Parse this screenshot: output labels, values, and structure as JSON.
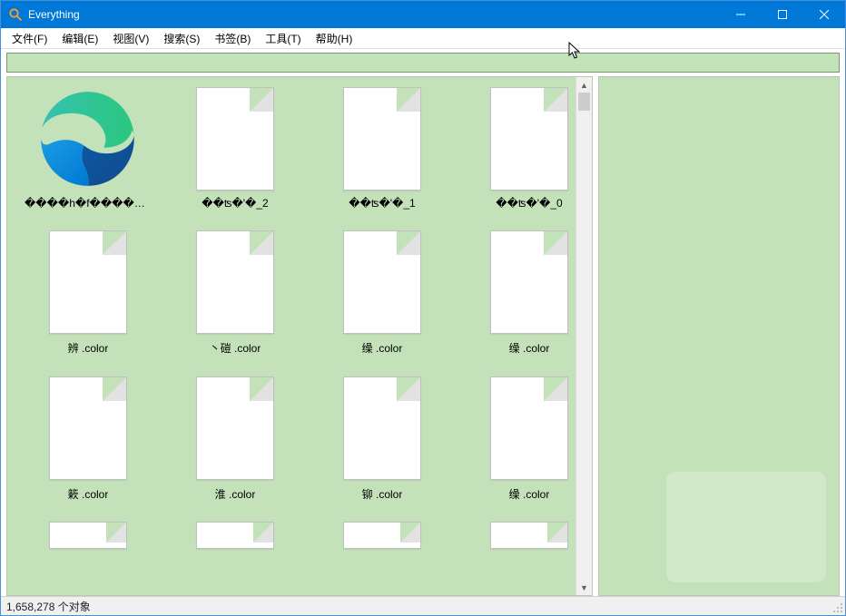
{
  "window": {
    "title": "Everything"
  },
  "menu": {
    "items": [
      "文件(F)",
      "编辑(E)",
      "视图(V)",
      "搜索(S)",
      "书签(B)",
      "工具(T)",
      "帮助(H)"
    ]
  },
  "search": {
    "value": "",
    "placeholder": ""
  },
  "results": {
    "items": [
      {
        "icon": "edge",
        "label": "����h�f���������...."
      },
      {
        "icon": "blank",
        "label": "��ʦ�'�_2"
      },
      {
        "icon": "blank",
        "label": "��ʦ�'�_1"
      },
      {
        "icon": "blank",
        "label": "��ʦ�'�_0"
      },
      {
        "icon": "blank",
        "label": "辨   .color"
      },
      {
        "icon": "blank",
        "label": "丶磑   .color"
      },
      {
        "icon": "blank",
        "label": "缲   .color"
      },
      {
        "icon": "blank",
        "label": "缲   .color"
      },
      {
        "icon": "blank",
        "label": "簌   .color"
      },
      {
        "icon": "blank",
        "label": "淮   .color"
      },
      {
        "icon": "blank",
        "label": "铆   .color"
      },
      {
        "icon": "blank",
        "label": "缲   .color"
      },
      {
        "icon": "blank",
        "label": "",
        "partial": true
      },
      {
        "icon": "blank",
        "label": "",
        "partial": true
      },
      {
        "icon": "blank",
        "label": "",
        "partial": true
      },
      {
        "icon": "blank",
        "label": "",
        "partial": true
      }
    ]
  },
  "statusbar": {
    "text": "1,658,278 个对象"
  }
}
